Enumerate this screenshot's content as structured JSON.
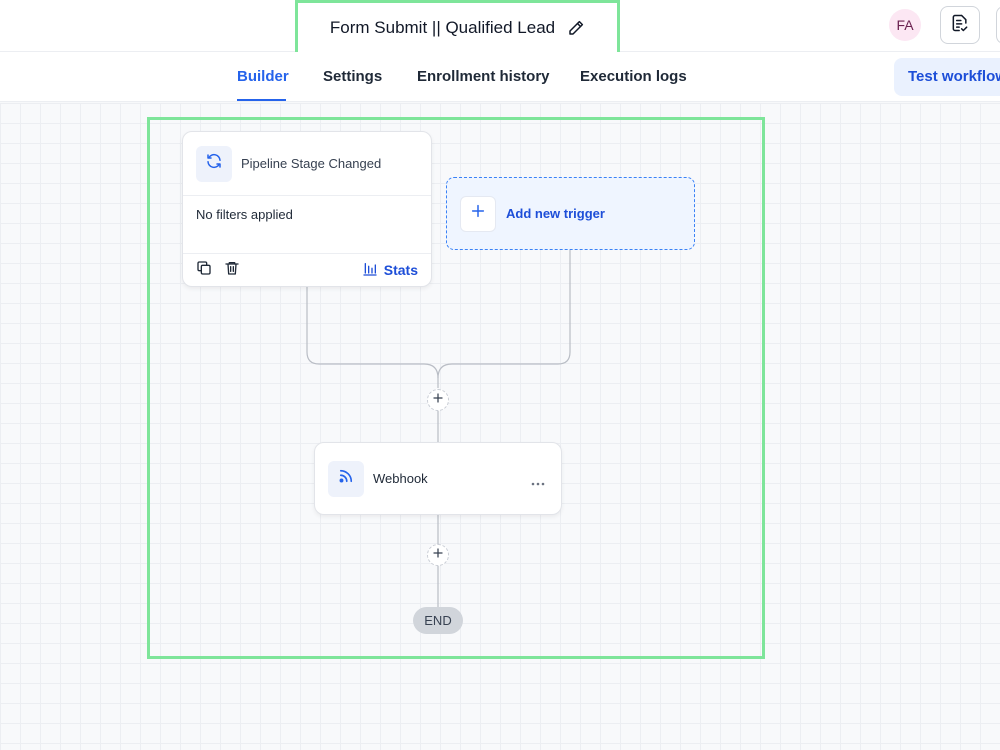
{
  "header": {
    "title": "Form Submit || Qualified Lead",
    "edit_icon": "pencil-icon",
    "avatar_initials": "FA",
    "doc_icon": "document-check-icon"
  },
  "tabs": [
    {
      "label": "Builder",
      "active": true
    },
    {
      "label": "Settings",
      "active": false
    },
    {
      "label": "Enrollment history",
      "active": false
    },
    {
      "label": "Execution logs",
      "active": false
    }
  ],
  "test_button_label": "Test workflow",
  "trigger": {
    "icon": "refresh-icon",
    "title": "Pipeline Stage Changed",
    "filters": "No filters applied",
    "copy_icon": "copy-icon",
    "delete_icon": "trash-icon",
    "stats_icon": "bar-chart-icon",
    "stats_label": "Stats"
  },
  "add_trigger": {
    "icon": "plus-icon",
    "label": "Add new trigger"
  },
  "action": {
    "icon": "rss-icon",
    "title": "Webhook",
    "menu_icon": "more-horizontal-icon"
  },
  "end_label": "END",
  "colors": {
    "accent": "#2563eb",
    "highlight": "#7ee59a",
    "add_trigger_bg": "#eff5ff",
    "end_pill": "#d1d5db"
  }
}
